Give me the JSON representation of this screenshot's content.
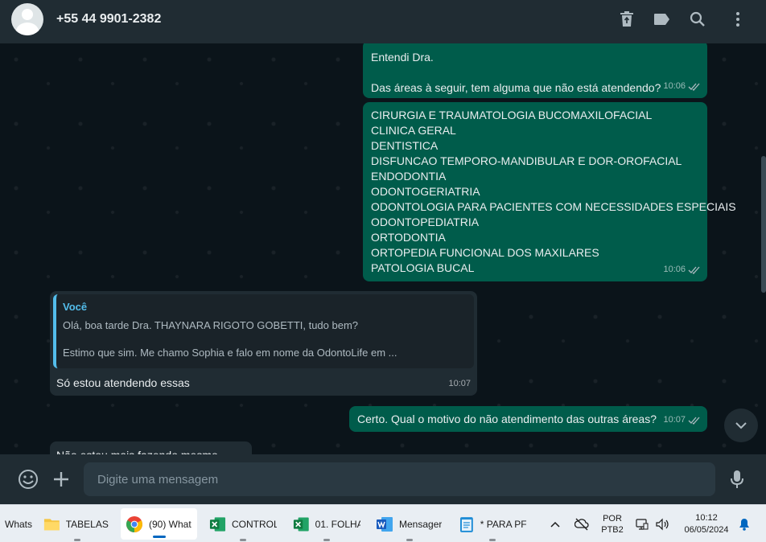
{
  "header": {
    "contact": "+55 44 9901-2382",
    "icons": [
      "trash-icon",
      "label-icon",
      "search-icon",
      "menu-dots-icon"
    ]
  },
  "messages": [
    {
      "direction": "outgoing",
      "lines": [
        "Entendi Dra.",
        "",
        "Das áreas à seguir, tem alguma que não está atendendo?"
      ],
      "time": "10:06",
      "status": "read"
    },
    {
      "direction": "outgoing",
      "lines": [
        "CIRURGIA E TRAUMATOLOGIA BUCOMAXILOFACIAL",
        "CLINICA GERAL",
        "DENTISTICA",
        "DISFUNCAO TEMPORO-MANDIBULAR E DOR-OROFACIAL",
        "ENDODONTIA",
        "ODONTOGERIATRIA",
        "ODONTOLOGIA PARA PACIENTES COM NECESSIDADES ESPECIAIS",
        "ODONTOPEDIATRIA",
        "ORTODONTIA",
        "ORTOPEDIA FUNCIONAL DOS MAXILARES",
        "PATOLOGIA BUCAL"
      ],
      "time": "10:06",
      "status": "read"
    },
    {
      "direction": "incoming",
      "quote": {
        "author": "Você",
        "line1": "Olá, boa tarde Dra. THAYNARA RIGOTO GOBETTI, tudo bem?",
        "line2": "Estimo que sim. Me chamo Sophia e falo em nome da OdontoLife em ..."
      },
      "text": "Só estou atendendo essas",
      "time": "10:07"
    },
    {
      "direction": "outgoing",
      "text": "Certo. Qual o motivo do não atendimento das outras áreas?",
      "time": "10:07",
      "status": "read"
    },
    {
      "direction": "incoming",
      "text": "Não estou mais fazendo mesmo"
    }
  ],
  "composer": {
    "placeholder": "Digite uma mensagem"
  },
  "taskbar": {
    "items": [
      {
        "label": "Whats",
        "icon": "whatsapp-icon"
      },
      {
        "label": "TABELAS /",
        "icon": "folder-icon"
      },
      {
        "label": "(90) What",
        "icon": "chrome-icon",
        "active": true
      },
      {
        "label": "CONTROL",
        "icon": "excel-icon"
      },
      {
        "label": "01. FOLHA",
        "icon": "excel-icon"
      },
      {
        "label": "Mensager",
        "icon": "word-icon"
      },
      {
        "label": "* PARA PF",
        "icon": "notepad-icon"
      }
    ],
    "lang_top": "POR",
    "lang_bottom": "PTB2",
    "time": "10:12",
    "date": "06/05/2024"
  },
  "colors": {
    "outgoing": "#005c4b",
    "incoming": "#202c33",
    "header": "#202c33",
    "accent_quote": "#53bdeb"
  }
}
